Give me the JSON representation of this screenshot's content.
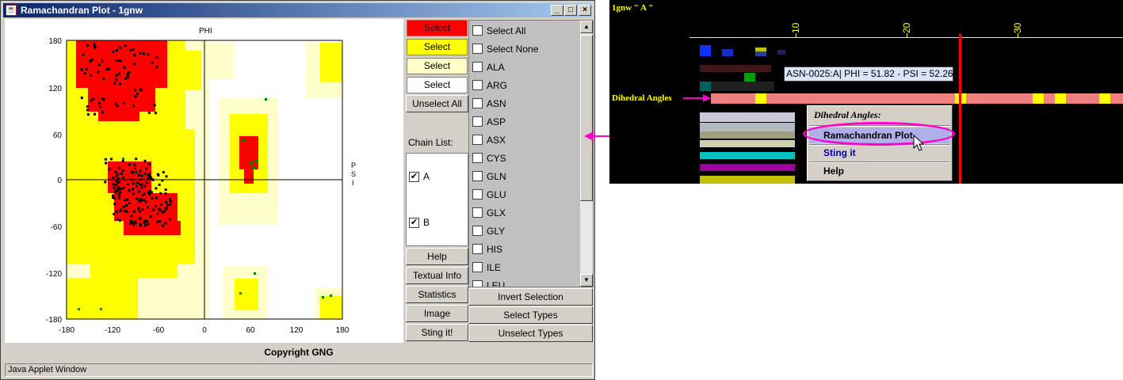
{
  "window": {
    "title": "Ramachandran Plot - 1gnw",
    "controls": {
      "minimize": "_",
      "maximize": "□",
      "close": "×"
    },
    "copyright": "Copyright GNG",
    "status": "Java Applet Window"
  },
  "plot": {
    "top_label": "PHI",
    "right_label": [
      "P",
      "S",
      "I"
    ],
    "x_ticks": [
      "-180",
      "-120",
      "-60",
      "0",
      "60",
      "120",
      "180"
    ],
    "y_ticks": [
      "180",
      "120",
      "60",
      "0",
      "-60",
      "-120",
      "-180"
    ],
    "colors": {
      "core": "#ff0000",
      "allowed": "#ffff00",
      "generous": "#ffffcc",
      "points": "#000000",
      "glycine": "#008000"
    }
  },
  "color_buttons": [
    {
      "label": "Select",
      "color": "#ff0000"
    },
    {
      "label": "Select",
      "color": "#ffff00"
    },
    {
      "label": "Select",
      "color": "#ffffc8"
    },
    {
      "label": "Select",
      "color": "#ffffff"
    }
  ],
  "unselect_all": "Unselect All",
  "chain_list": {
    "label": "Chain List:",
    "chains": [
      {
        "name": "A",
        "checked": true
      },
      {
        "name": "B",
        "checked": true
      }
    ]
  },
  "action_buttons": [
    "Help",
    "Textual Info",
    "Statistics",
    "Image",
    "Sting it!"
  ],
  "residue_list": [
    "Select All",
    "Select None",
    "ALA",
    "ARG",
    "ASN",
    "ASP",
    "ASX",
    "CYS",
    "GLN",
    "GLU",
    "GLX",
    "GLY",
    "HIS",
    "ILE",
    "LEU"
  ],
  "bottom_buttons": [
    "Invert Selection",
    "Select Types",
    "Unselect Types"
  ],
  "sequence_view": {
    "title": "1gnw \" A \"",
    "ticks": [
      "10",
      "20",
      "30"
    ],
    "track_label": "Dihedral Angles",
    "tooltip": "ASN-0025:A| PHI = 51.82 - PSI = 52.26",
    "context_menu": {
      "header": "Dihedral Angles:",
      "items": [
        {
          "label": "Ramachandran Plot",
          "color": "#000000",
          "highlighted": true
        },
        {
          "label": "Sting it",
          "color": "#0000aa"
        },
        {
          "label": "Help",
          "color": "#000000"
        }
      ]
    }
  }
}
